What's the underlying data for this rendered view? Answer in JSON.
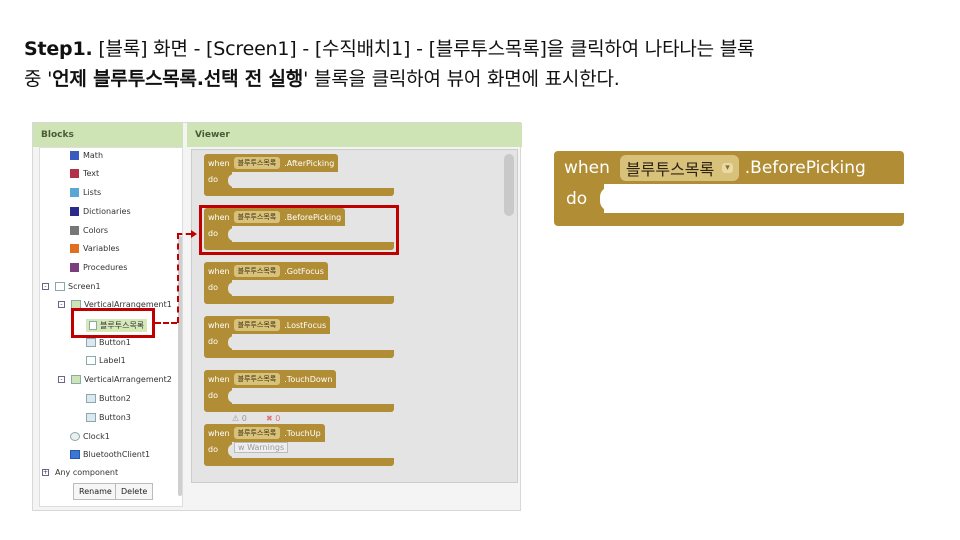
{
  "instruction": {
    "line1_bold": "Step1.",
    "line1_rest": " [블록] 화면 - [Screen1] - [수직배치1] - [블루투스목록]을 클릭하여 나타나는 블록",
    "line2_pre": "중 '",
    "line2_bold": "언제 블루투스목록.선택 전 실행",
    "line2_post": "' 블록을 클릭하여 뷰어 화면에 표시한다."
  },
  "blocks_panel": {
    "header": "Blocks",
    "items": [
      {
        "label": "Math",
        "color": "#3b5bbf"
      },
      {
        "label": "Text",
        "color": "#b3304a"
      },
      {
        "label": "Lists",
        "color": "#5aa6d6"
      },
      {
        "label": "Dictionaries",
        "color": "#2a2a8a"
      },
      {
        "label": "Colors",
        "color": "#777777"
      },
      {
        "label": "Variables",
        "color": "#e07020"
      },
      {
        "label": "Procedures",
        "color": "#7b3f7e"
      }
    ],
    "screen": "Screen1",
    "arrangement1": "VerticalArrangement1",
    "selected": "블루투스목록",
    "button1": "Button1",
    "label1": "Label1",
    "arrangement2": "VerticalArrangement2",
    "button2": "Button2",
    "button3": "Button3",
    "clock": "Clock1",
    "bluetooth": "BluetoothClient1",
    "any": "Any component",
    "rename": "Rename",
    "delete": "Delete"
  },
  "viewer": {
    "header": "Viewer",
    "when": "when",
    "do": "do",
    "component": "블루투스목록",
    "events": [
      ".AfterPicking",
      ".BeforePicking",
      ".GotFocus",
      ".LostFocus",
      ".TouchDown",
      ".TouchUp"
    ],
    "warn_a": "0",
    "warn_b": "0",
    "warnings": "w Warnings"
  },
  "enlarged": {
    "when": "when",
    "component": "블루투스목록",
    "dropdown": "▾",
    "event": ".BeforePicking",
    "do": "do"
  },
  "colors": {
    "block": "#b18e35",
    "highlight": "#c00000",
    "header": "#cfe4b4"
  }
}
